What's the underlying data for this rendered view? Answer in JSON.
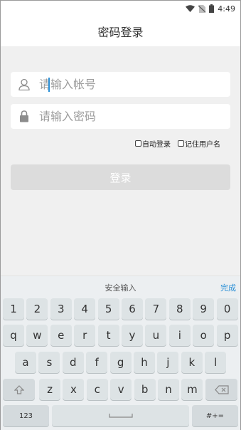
{
  "status_bar": {
    "time": "4:49"
  },
  "title": "密码登录",
  "account": {
    "placeholder": "请输入帐号",
    "value": ""
  },
  "password": {
    "placeholder": "请输入密码",
    "value": ""
  },
  "options": {
    "auto_login": "自动登录",
    "remember_username": "记住用户名"
  },
  "login_label": "登录",
  "keyboard": {
    "title": "安全输入",
    "done_label": "完成",
    "row1": [
      "1",
      "2",
      "3",
      "4",
      "5",
      "6",
      "7",
      "8",
      "9",
      "0"
    ],
    "row2": [
      "q",
      "w",
      "e",
      "r",
      "t",
      "y",
      "u",
      "i",
      "o",
      "p"
    ],
    "row3": [
      "a",
      "s",
      "d",
      "f",
      "g",
      "h",
      "j",
      "k",
      "l"
    ],
    "row4": [
      "z",
      "x",
      "c",
      "v",
      "b",
      "n",
      "m"
    ],
    "numbers_label": "123",
    "symbols_label": "#+="
  },
  "colors": {
    "accent": "#2a8fd6",
    "login_disabled": "#dcdcdc",
    "key_bg": "#dde3e5"
  }
}
